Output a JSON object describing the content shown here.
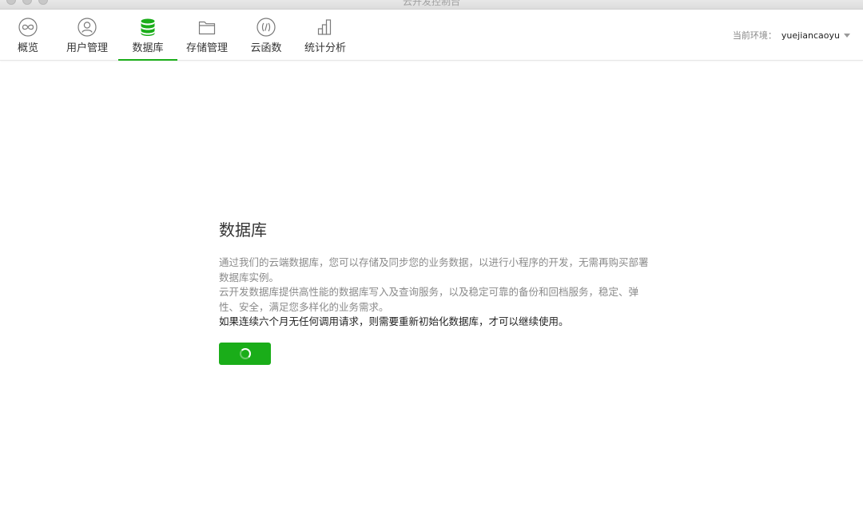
{
  "window": {
    "title": "云开发控制台"
  },
  "nav": {
    "tabs": [
      {
        "label": "概览",
        "icon": "infinity-icon"
      },
      {
        "label": "用户管理",
        "icon": "user-icon"
      },
      {
        "label": "数据库",
        "icon": "database-icon",
        "active": true
      },
      {
        "label": "存储管理",
        "icon": "folder-icon"
      },
      {
        "label": "云函数",
        "icon": "function-icon"
      },
      {
        "label": "统计分析",
        "icon": "bar-chart-icon"
      }
    ]
  },
  "env": {
    "label": "当前环境：",
    "value": "yuejiancaoyu"
  },
  "main": {
    "title": "数据库",
    "desc1": "通过我们的云端数据库，您可以存储及同步您的业务数据，以进行小程序的开发，无需再购买部署数据库实例。",
    "desc2": "云开发数据库提供高性能的数据库写入及查询服务，以及稳定可靠的备份和回档服务，稳定、弹性、安全，满足您多样化的业务需求。",
    "warning": "如果连续六个月无任何调用请求，则需要重新初始化数据库，才可以继续使用。",
    "init_button": {
      "state": "loading",
      "icon": "loading-spinner-icon"
    }
  },
  "colors": {
    "accent": "#1aad19",
    "active_icon": "#1aad19",
    "icon_stroke": "#7a7a7a"
  }
}
